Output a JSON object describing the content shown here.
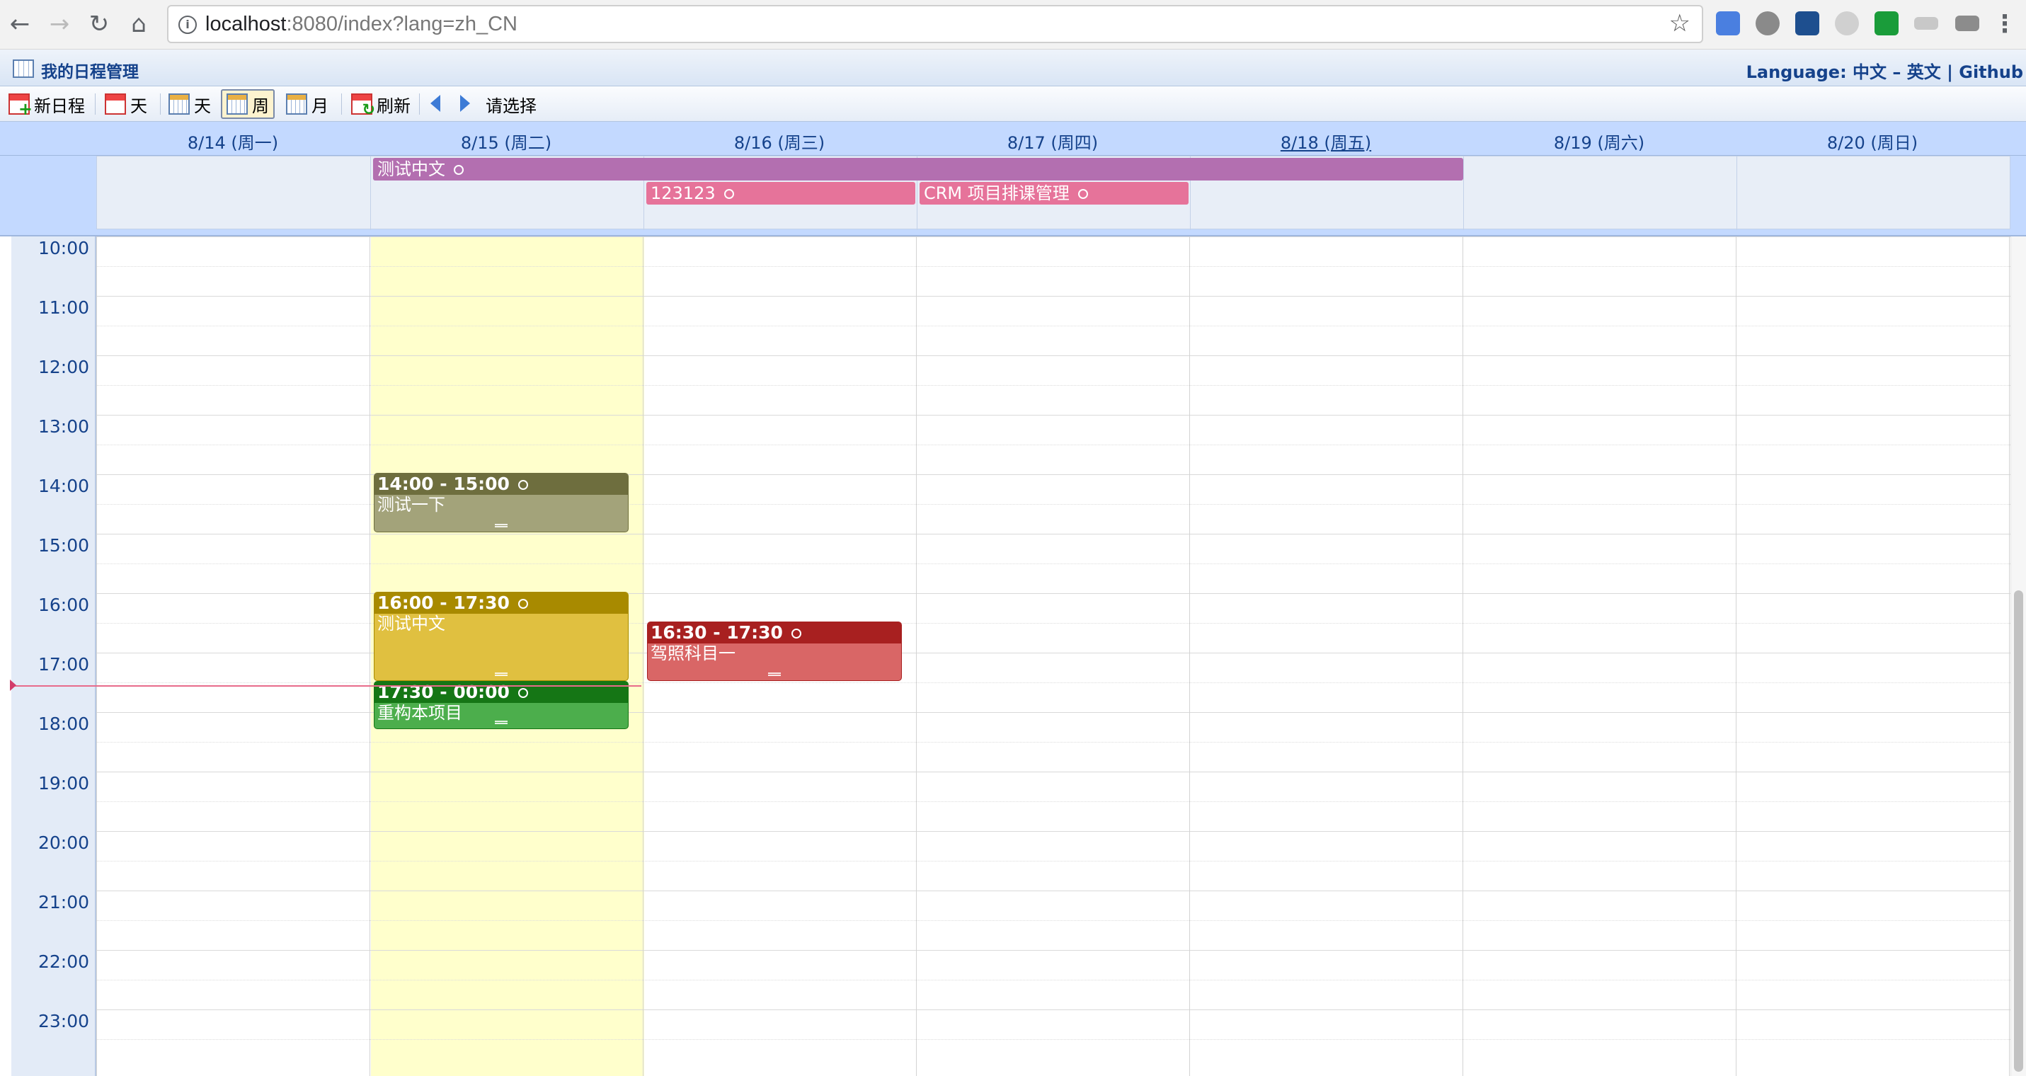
{
  "browser": {
    "url_host": "localhost",
    "url_rest": ":8080/index?lang=zh_CN"
  },
  "app": {
    "title": "我的日程管理",
    "language_label": "Language:",
    "lang_zh": "中文",
    "lang_dash": "–",
    "lang_en": "英文",
    "lang_sep": "|",
    "github": "Github"
  },
  "toolbar": {
    "new_event": "新日程",
    "day": "天",
    "week": "周",
    "month": "月",
    "refresh": "刷新",
    "select": "请选择"
  },
  "days": [
    "8/14 (周一)",
    "8/15 (周二)",
    "8/16 (周三)",
    "8/17 (周四)",
    "8/18 (周五)",
    "8/19 (周六)",
    "8/20 (周日)"
  ],
  "all_day_events": [
    {
      "title": "测试中文",
      "color": "#b36fb0"
    },
    {
      "title": "123123",
      "color": "#e6739a"
    },
    {
      "title": "CRM 项目排课管理",
      "color": "#e6739a"
    }
  ],
  "times": [
    "10:00",
    "11:00",
    "12:00",
    "13:00",
    "14:00",
    "15:00",
    "16:00",
    "17:00",
    "18:00",
    "19:00",
    "20:00",
    "21:00",
    "22:00",
    "23:00"
  ],
  "events": [
    {
      "time": "14:00 - 15:00",
      "title": "测试一下",
      "head_color": "#6e6e3e",
      "body_color": "#a3a37a"
    },
    {
      "time": "16:00 - 17:30",
      "title": "测试中文",
      "head_color": "#a88a00",
      "body_color": "#e0c040"
    },
    {
      "time": "17:30 - 00:00",
      "title": "重构本项目",
      "head_color": "#157615",
      "body_color": "#4cae4c"
    },
    {
      "time": "16:30 - 17:30",
      "title": "驾照科目一",
      "head_color": "#a82020",
      "body_color": "#d96666"
    }
  ]
}
